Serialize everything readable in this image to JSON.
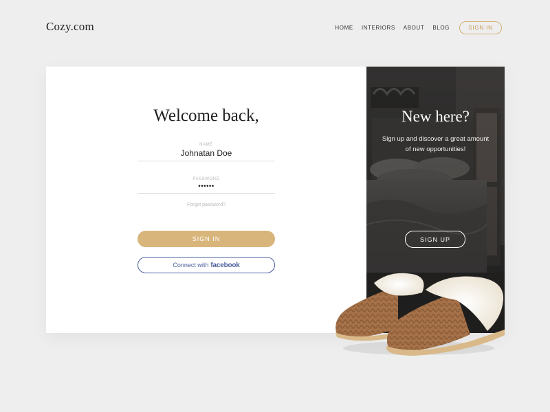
{
  "brand": {
    "logo": "Cozy.com"
  },
  "nav": {
    "items": [
      "HOME",
      "INTERIORS",
      "ABOUT",
      "BLOG"
    ],
    "signin_label": "SIGN IN"
  },
  "login": {
    "title": "Welcome back,",
    "name_label": "NAME",
    "name_value": "Johnatan Doe",
    "password_label": "PASSWORD",
    "password_value": "••••••",
    "forgot_label": "Forgot password?",
    "signin_button": "SIGN IN",
    "facebook_prefix": "Connect with",
    "facebook_word": "facebook"
  },
  "signup": {
    "title": "New here?",
    "subtitle": "Sign up and discover a great amount of new opportunities!",
    "button": "SIGN UP"
  },
  "colors": {
    "accent": "#d8b57b",
    "facebook": "#4a5f9c",
    "background": "#eeeeee"
  },
  "icons": {
    "decor": "slippers-illustration",
    "bedroom": "bedroom-photo"
  }
}
